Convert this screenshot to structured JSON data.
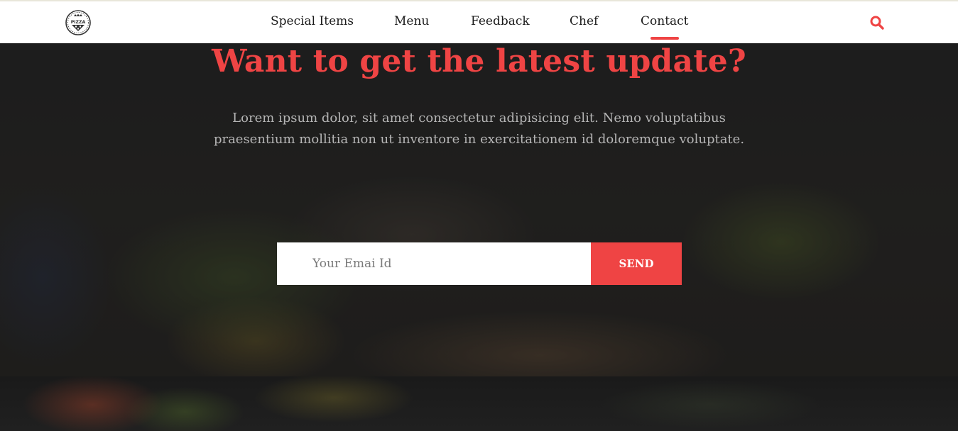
{
  "nav": {
    "logo_text": "PIZZA",
    "links": [
      {
        "label": "Special Items"
      },
      {
        "label": "Menu"
      },
      {
        "label": "Feedback"
      },
      {
        "label": "Chef"
      },
      {
        "label": "Contact",
        "active": true
      }
    ],
    "search_icon": "search-icon"
  },
  "hero": {
    "title": "Want to get the latest update?",
    "description": "Lorem ipsum dolor, sit amet consectetur adipisicing elit. Nemo voluptatibus praesentium mollitia non ut inventore in exercitationem id doloremque voluptate."
  },
  "subscribe": {
    "placeholder": "Your Emai Id",
    "button_label": "SEND"
  },
  "colors": {
    "accent": "#ef4444",
    "nav_bg": "#ffffff",
    "text_dark": "#1a1a1a",
    "desc_text": "#b5b5b5"
  }
}
